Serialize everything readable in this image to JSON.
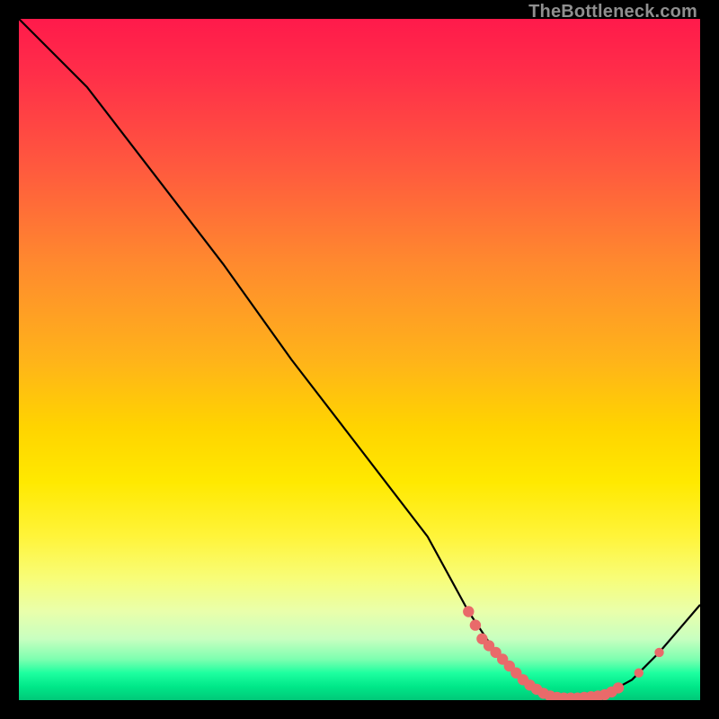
{
  "watermark": "TheBottleneck.com",
  "colors": {
    "page_bg": "#000000",
    "curve_stroke": "#000000",
    "marker_fill": "#e96a6a",
    "watermark_text": "#8f8f8f",
    "gradient_top": "#ff1a4b",
    "gradient_bottom": "#00c878"
  },
  "chart_data": {
    "type": "line",
    "title": "",
    "xlabel": "",
    "ylabel": "",
    "xlim": [
      0,
      100
    ],
    "ylim": [
      0,
      100
    ],
    "grid": false,
    "legend": false,
    "series": [
      {
        "name": "bottleneck-curve",
        "x": [
          0,
          6,
          10,
          20,
          30,
          40,
          50,
          60,
          66,
          70,
          74,
          78,
          82,
          86,
          90,
          94,
          100
        ],
        "y": [
          100,
          94,
          90,
          77,
          64,
          50,
          37,
          24,
          13,
          7,
          3,
          0.6,
          0.3,
          0.8,
          3,
          7,
          14
        ]
      }
    ],
    "markers": {
      "name": "highlighted-points",
      "note": "dense cluster of markers along the valley floor and a few on the right upslope",
      "x": [
        66,
        67,
        68,
        69,
        70,
        71,
        72,
        73,
        74,
        75,
        76,
        77,
        78,
        79,
        80,
        81,
        82,
        83,
        84,
        85,
        86,
        87,
        88,
        91,
        94
      ],
      "y": [
        13,
        11,
        9,
        8,
        7,
        6,
        5,
        4,
        3,
        2.2,
        1.6,
        1.0,
        0.6,
        0.4,
        0.3,
        0.3,
        0.3,
        0.4,
        0.5,
        0.6,
        0.8,
        1.2,
        1.8,
        4,
        7
      ]
    }
  }
}
